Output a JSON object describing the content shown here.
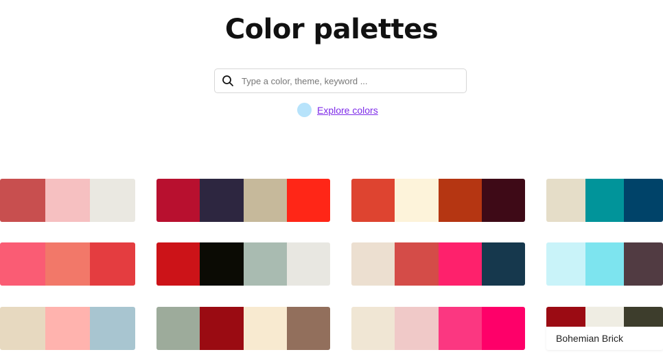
{
  "header": {
    "title": "Color palettes"
  },
  "search": {
    "placeholder": "Type a color, theme, keyword ..."
  },
  "explore": {
    "label": "Explore colors",
    "dot_color": "#b7e3fb"
  },
  "palettes": [
    {
      "colors": [
        "#c84f4f",
        "#f6c0c1",
        "#eae8e1"
      ]
    },
    {
      "colors": [
        "#b8102f",
        "#2d2640",
        "#c6b99b",
        "#ff2617"
      ]
    },
    {
      "colors": [
        "#de4430",
        "#fdf3da",
        "#b53612",
        "#3e0a17"
      ]
    },
    {
      "colors": [
        "#e5ddc8",
        "#01949a",
        "#004369"
      ]
    },
    {
      "colors": [
        "#fa5c74",
        "#f27869",
        "#e43d40"
      ]
    },
    {
      "colors": [
        "#cc1318",
        "#0b0b04",
        "#a9bbb1",
        "#e8e7e1"
      ]
    },
    {
      "colors": [
        "#ecdfd0",
        "#d44c48",
        "#fe216c",
        "#16384d"
      ]
    },
    {
      "colors": [
        "#c9f3f9",
        "#7de4ef",
        "#513b42"
      ]
    },
    {
      "colors": [
        "#e7d9c0",
        "#ffb3ae",
        "#a8c5d0"
      ]
    },
    {
      "colors": [
        "#9dab9b",
        "#9a0b12",
        "#f8ead0",
        "#926f5c"
      ]
    },
    {
      "colors": [
        "#f0e6d4",
        "#f0c9c8",
        "#fb3781",
        "#fe0069"
      ]
    },
    {
      "colors": [
        "#9b0b13",
        "#efede3",
        "#3d3d2c"
      ],
      "name": "Bohemian Brick"
    }
  ]
}
